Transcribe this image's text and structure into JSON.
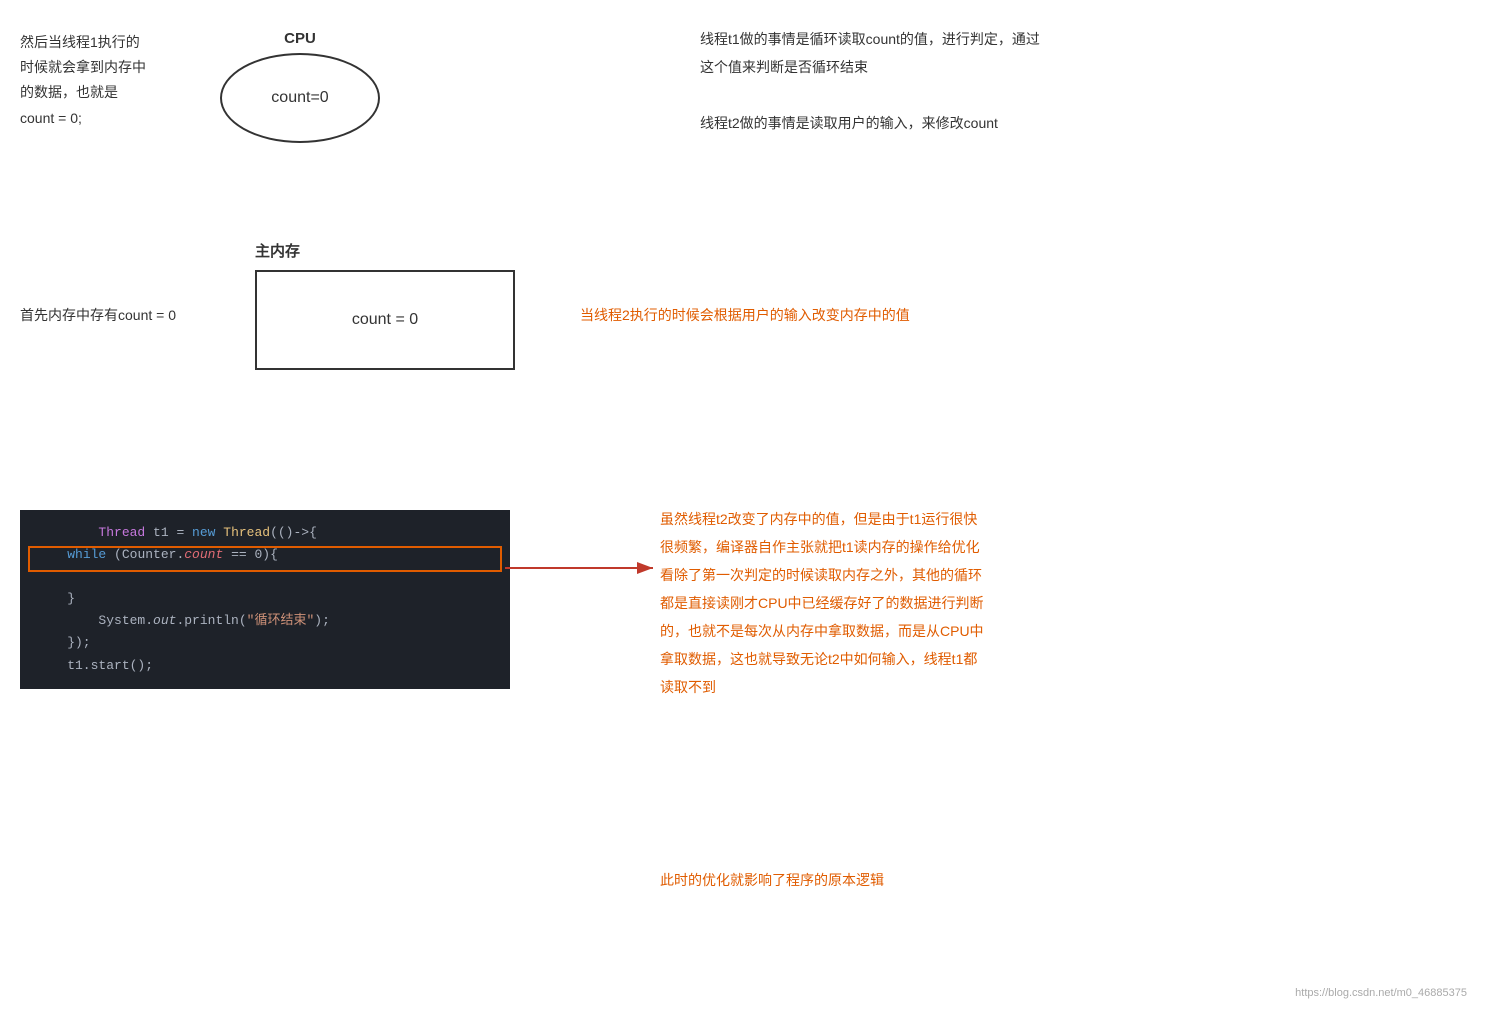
{
  "cpu": {
    "label": "CPU",
    "content": "count=0",
    "left_text_line1": "然后当线程1执行的",
    "left_text_line2": "时候就会拿到内存中",
    "left_text_line3": "的数据，也就是",
    "left_text_line4": "count = 0;"
  },
  "right_top": {
    "line1": "线程t1做的事情是循环读取count的值，进行判定，通过",
    "line2": "这个值来判断是否循环结束",
    "line3": "线程t2做的事情是读取用户的输入，来修改count"
  },
  "memory": {
    "label": "主内存",
    "content": "count = 0",
    "left_text": "首先内存中存有count = 0",
    "right_text": "当线程2执行的时候会根据用户的输入改变内存中的值"
  },
  "code_right": {
    "line1": "虽然线程t2改变了内存中的值，但是由于t1运行很快",
    "line2": "很频繁，编译器自作主张就把t1读内存的操作给优化",
    "line3": "看除了第一次判定的时候读取内存之外，其他的循环",
    "line4": "都是直接读刚才CPU中已经缓存好了的数据进行判断",
    "line5": "的，也就不是每次从内存中拿取数据，而是从CPU中",
    "line6": "拿取数据，这也就导致无论t2中如何输入，线程t1都",
    "line7": "读取不到"
  },
  "bottom": {
    "note": "此时的优化就影响了程序的原本逻辑"
  },
  "watermark": {
    "text": "https://blog.csdn.net/m0_46885375"
  }
}
